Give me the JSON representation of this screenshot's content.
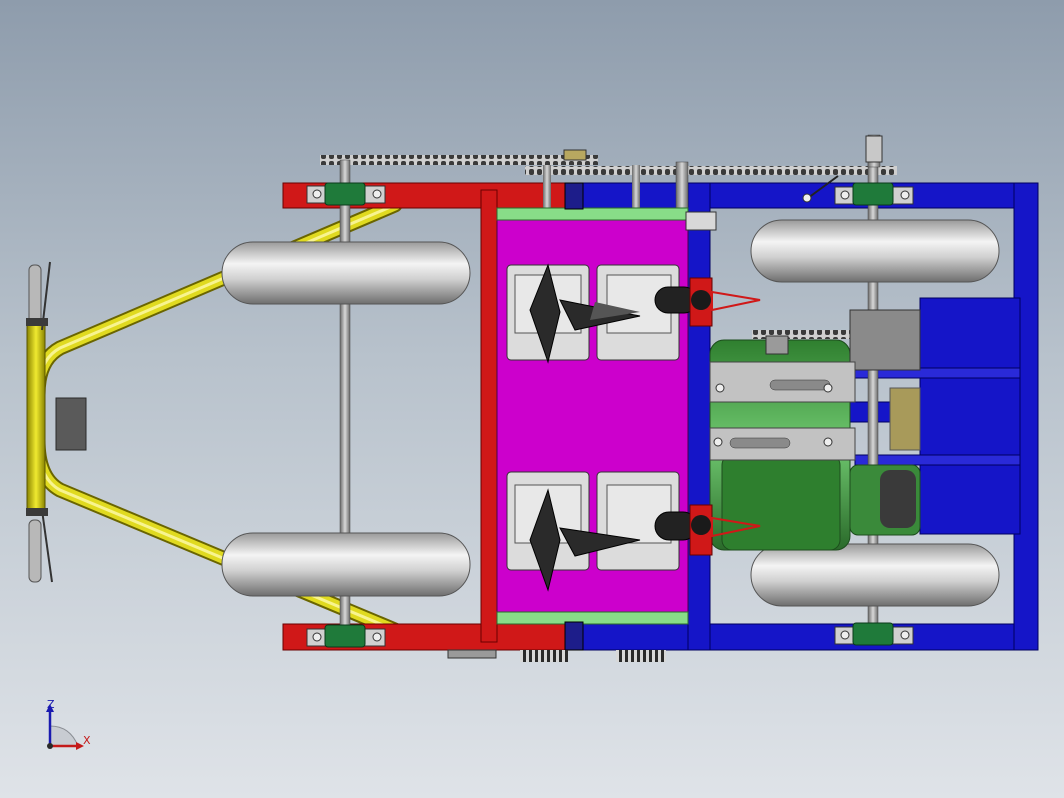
{
  "viewport": {
    "background_top": "#8e9cac",
    "background_bottom": "#dfe3e8"
  },
  "model": {
    "parts": {
      "front_frame": {
        "color": "#d01818"
      },
      "rear_frame": {
        "color": "#1515c8"
      },
      "planting_box": {
        "color": "#cc00cc"
      },
      "handle": {
        "color": "#d8d000"
      },
      "wheels": {
        "color": "#c8c8c8"
      },
      "motor": {
        "color": "#3a9a3a"
      },
      "bearings": {
        "color": "#1f7a3a"
      },
      "chain": {
        "color": "#505050"
      }
    }
  },
  "triad": {
    "z_label": "Z",
    "x_label": "X",
    "z_color": "#1a1ab0",
    "x_color": "#c41a1a"
  }
}
